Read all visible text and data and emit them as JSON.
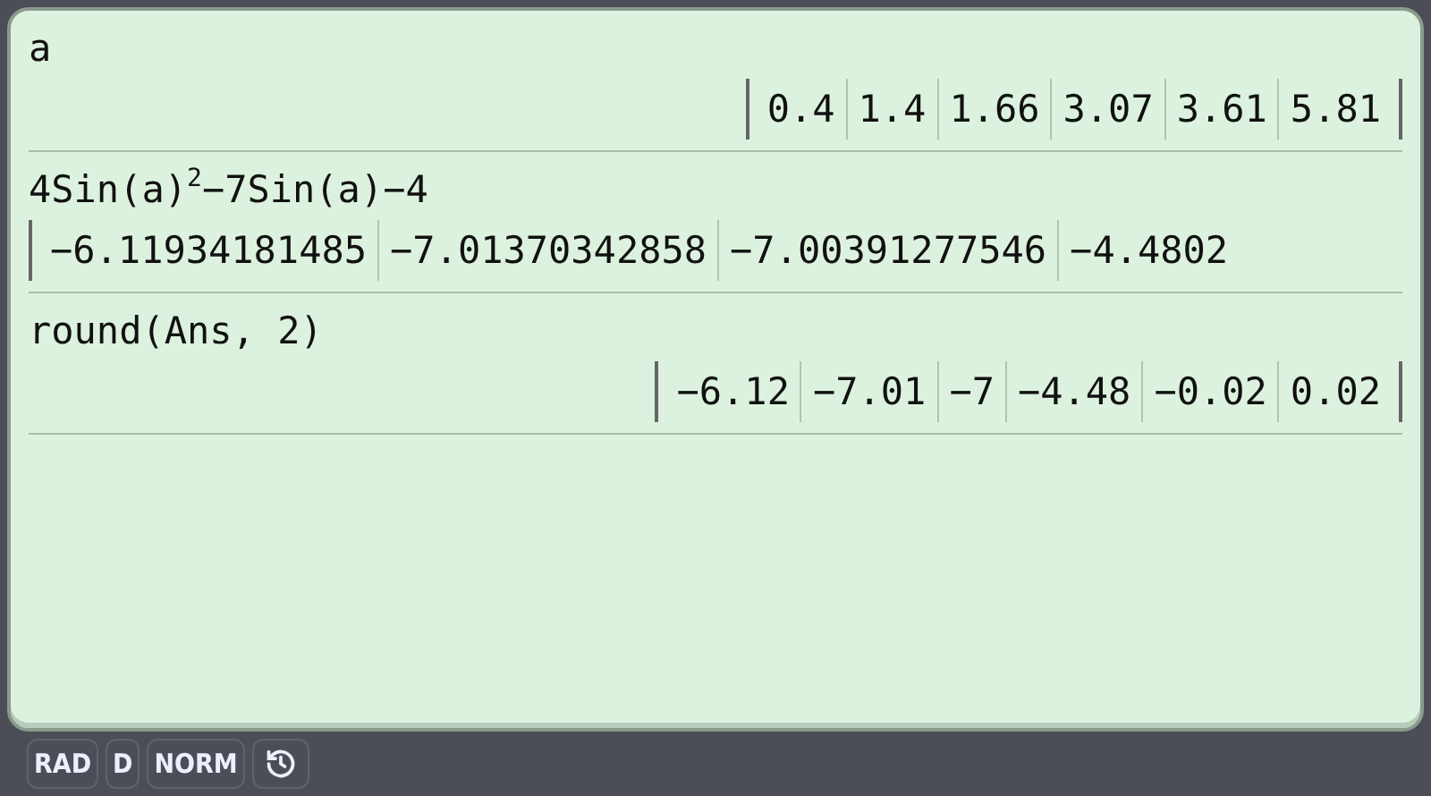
{
  "history": [
    {
      "input": "a",
      "output": [
        "0.4",
        "1.4",
        "1.66",
        "3.07",
        "3.61",
        "5.81"
      ],
      "cut_off": false
    },
    {
      "input": "4Sin(a)$^{2}$−7Sin(a)−4",
      "output": [
        "−6.11934181485",
        "−7.01370342858",
        "−7.00391277546",
        "−4.4802"
      ],
      "cut_off": true
    },
    {
      "input": "round(Ans, 2)",
      "output": [
        "−6.12",
        "−7.01",
        "−7",
        "−4.48",
        "−0.02",
        "0.02"
      ],
      "cut_off": false
    }
  ],
  "status_bar": {
    "buttons": [
      "RAD",
      "D",
      "NORM"
    ]
  }
}
